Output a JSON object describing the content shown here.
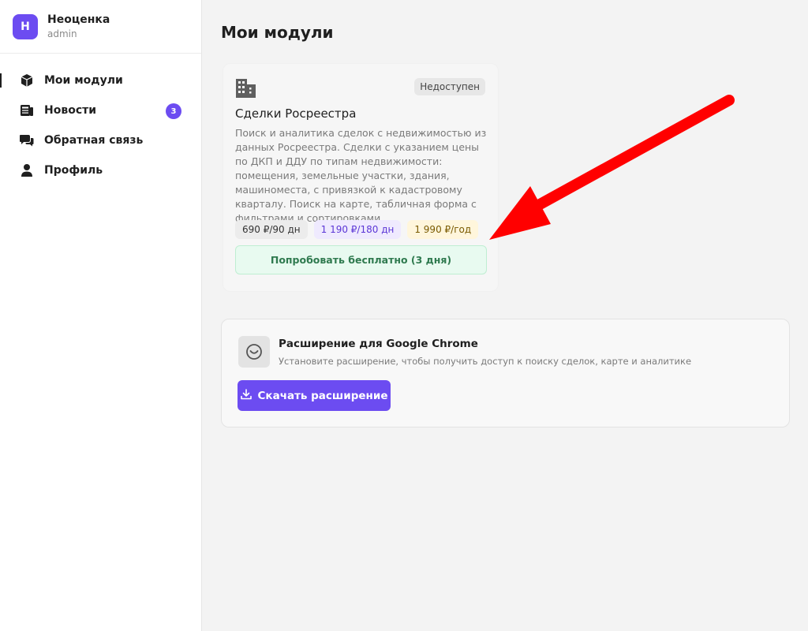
{
  "brand": {
    "logo_letter": "Н",
    "name": "Неоценка",
    "role": "admin"
  },
  "sidebar": {
    "items": [
      {
        "label": "Мои модули",
        "icon": "cube-icon",
        "active": true
      },
      {
        "label": "Новости",
        "icon": "newspaper-icon",
        "badge": "3"
      },
      {
        "label": "Обратная связь",
        "icon": "chat-bubbles-icon"
      },
      {
        "label": "Профиль",
        "icon": "user-icon"
      }
    ]
  },
  "main": {
    "title": "Мои модули",
    "module": {
      "icon": "building-icon",
      "status": "Недоступен",
      "title": "Сделки Росреестра",
      "description": "Поиск и аналитика сделок с недвижимостью из данных Росреестра. Сделки с указанием цены по ДКП и ДДУ по типам недвижимости: помещения, земельные участки, здания, машиноместа, с привязкой к кадастровому кварталу. Поиск на карте, табличная форма с фильтрами и сортировками.",
      "prices": [
        "690 ₽/90 дн",
        "1 190 ₽/180 дн",
        "1 990 ₽/год"
      ],
      "trial_label": "Попробовать бесплатно (3 дня)"
    },
    "extension": {
      "icon": "chrome-extension-icon",
      "title": "Расширение для Google Chrome",
      "subtitle": "Установите расширение, чтобы получить доступ к поиску сделок, карте и аналитике",
      "download_label": "Скачать расширение"
    }
  },
  "colors": {
    "accent": "#6c4cf1",
    "annotation_arrow": "#ff0000",
    "trial_bg": "#e8faf0"
  }
}
